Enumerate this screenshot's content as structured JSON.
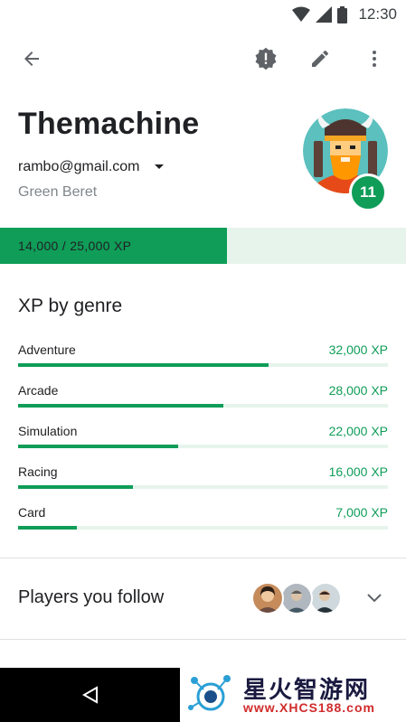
{
  "status_bar": {
    "time": "12:30"
  },
  "toolbar": {
    "back_icon": "arrow-back-icon",
    "report_icon": "report-icon",
    "edit_icon": "edit-icon",
    "more_icon": "more-vert-icon"
  },
  "profile": {
    "name": "Themachine",
    "email": "rambo@gmail.com",
    "title": "Green Beret",
    "level": "11"
  },
  "xp": {
    "label": "14,000 / 25,000 XP",
    "current": 14000,
    "max": 25000
  },
  "genres": {
    "title": "XP by genre",
    "items": [
      {
        "label": "Adventure",
        "value": "32,000 XP",
        "fraction": 0.677
      },
      {
        "label": "Arcade",
        "value": "28,000 XP",
        "fraction": 0.555
      },
      {
        "label": "Simulation",
        "value": "22,000 XP",
        "fraction": 0.433
      },
      {
        "label": "Racing",
        "value": "16,000 XP",
        "fraction": 0.311
      },
      {
        "label": "Card",
        "value": "7,000 XP",
        "fraction": 0.159
      }
    ]
  },
  "following": {
    "title": "Players you follow"
  },
  "watermark": {
    "name": "星火智游网",
    "url": "www.XHCS188.com"
  },
  "colors": {
    "accent": "#0f9d58",
    "track": "#e6f4ec",
    "text": "#202124",
    "secondary": "#80868b"
  }
}
